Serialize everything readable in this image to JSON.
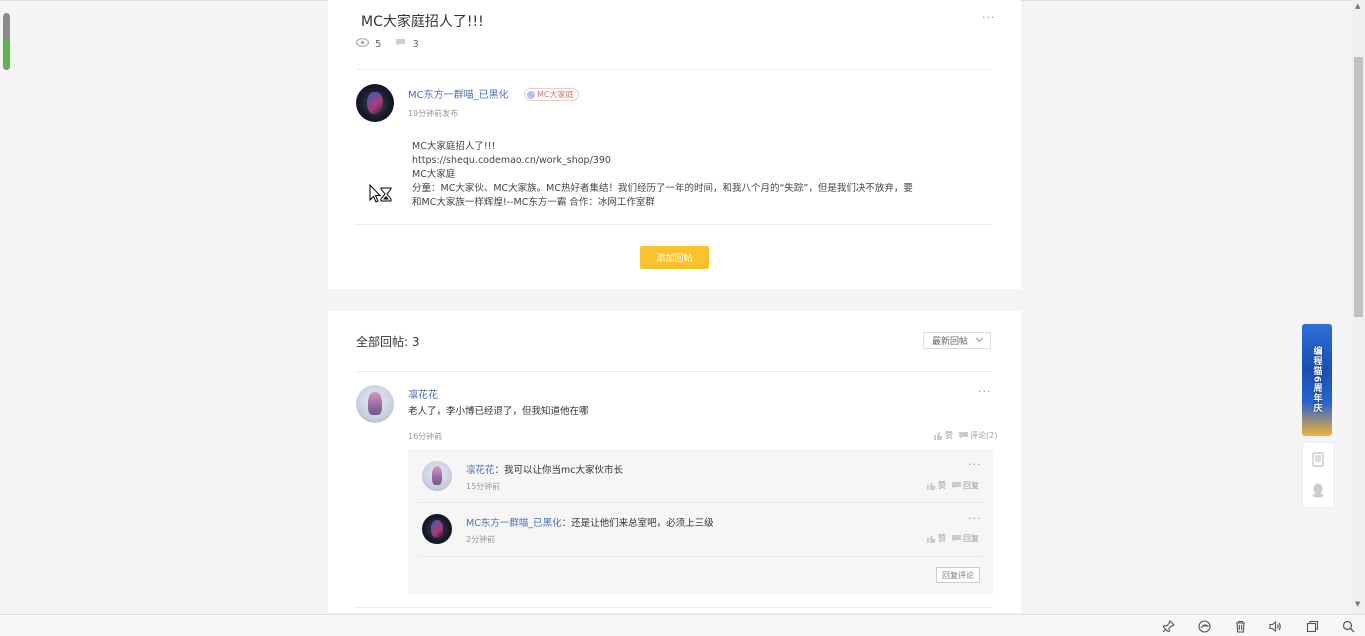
{
  "post": {
    "title": "MC大家庭招人了!!!",
    "views": "5",
    "comments": "3",
    "author": {
      "name": "MC东方一群喵_已黑化",
      "badge": "MC大家庭",
      "time": "19分钟前发布"
    },
    "body_lines": [
      "MC大家庭招人了!!!",
      "https://shequ.codemao.cn/work_shop/390",
      "MC大家庭",
      "分童：MC大家伙、MC大家族。MC热好者集结！我们经历了一年的时间，和我八个月的“失踪”，但是我们决不放弃，要",
      "和MC大家族一样辉煌!--MC东方一霸 合作：冰网工作室群"
    ],
    "add_reply_label": "添加回帖"
  },
  "replies": {
    "title": "全部回帖: 3",
    "sort_label": "最新回帖",
    "items": [
      {
        "author": "凛花花",
        "text": "老人了，李小博已经退了，但我知道他在哪",
        "time": "16分钟前",
        "like_label": "赞",
        "comment_label": "评论(2)",
        "sub_replies": [
          {
            "author": "凛花花",
            "sep": "：",
            "text": "我可以让你当mc大家伙市长",
            "time": "15分钟前",
            "like_label": "赞",
            "reply_label": "回复"
          },
          {
            "author": "MC东方一群喵_已黑化",
            "sep": "：",
            "text": "还是让他们来总室吧，必须上三级",
            "time": "2分钟前",
            "like_label": "赞",
            "reply_label": "回复"
          }
        ],
        "reply_comment_label": "回复评论"
      }
    ]
  },
  "side": {
    "banner_text": "编程猫6周年庆"
  },
  "colors": {
    "accent_button": "#f9c22e",
    "link": "#4a72b8",
    "badge_border": "#f0c8c8"
  },
  "icons": [
    "eye-icon",
    "comment-icon",
    "thumb-up-icon",
    "speech-bubble-icon",
    "more-icon",
    "chevron-down-icon",
    "tablet-icon",
    "qq-penguin-icon",
    "hourglass-cursor-icon",
    "pin-icon",
    "edge-icon",
    "trash-icon",
    "volume-icon",
    "window-icon",
    "search-icon"
  ]
}
